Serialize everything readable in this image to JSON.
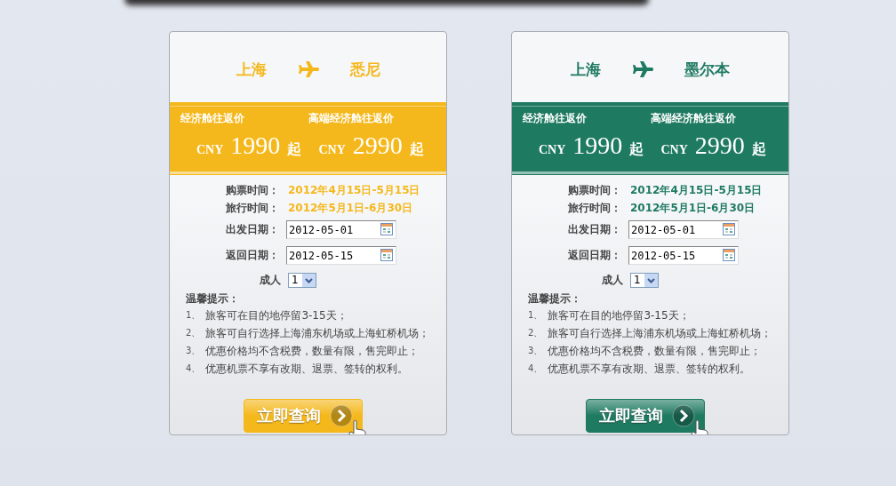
{
  "cards": [
    {
      "color": "#f5b81c",
      "origin": "上海",
      "destination": "悉尼",
      "prices": [
        {
          "label": "经济舱往返价",
          "currency": "CNY",
          "amount": "1990",
          "suffix": "起"
        },
        {
          "label": "高端经济舱往返价",
          "currency": "CNY",
          "amount": "2990",
          "suffix": "起"
        }
      ],
      "info": [
        {
          "label": "购票时间：",
          "value": "2012年4月15日-5月15日"
        },
        {
          "label": "旅行时间：",
          "value": "2012年5月1日-6月30日"
        }
      ],
      "fields": [
        {
          "label": "出发日期：",
          "value": "2012-05-01"
        },
        {
          "label": "返回日期：",
          "value": "2012-05-15"
        }
      ],
      "adults": {
        "label": "成人",
        "value": "1"
      },
      "tips_title": "温馨提示：",
      "tips": [
        {
          "num": "1、",
          "text": "旅客可在目的地停留3-15天；"
        },
        {
          "num": "2、",
          "text": "旅客可自行选择上海浦东机场或上海虹桥机场；"
        },
        {
          "num": "3、",
          "text": "优惠价格均不含税费，数量有限，售完即止；"
        },
        {
          "num": "4、",
          "text": "优惠机票不享有改期、退票、签转的权利。"
        }
      ],
      "button": "立即查询"
    },
    {
      "color": "#1f7a62",
      "origin": "上海",
      "destination": "墨尔本",
      "prices": [
        {
          "label": "经济舱往返价",
          "currency": "CNY",
          "amount": "1990",
          "suffix": "起"
        },
        {
          "label": "高端经济舱往返价",
          "currency": "CNY",
          "amount": "2990",
          "suffix": "起"
        }
      ],
      "info": [
        {
          "label": "购票时间：",
          "value": "2012年4月15日-5月15日"
        },
        {
          "label": "旅行时间：",
          "value": "2012年5月1日-6月30日"
        }
      ],
      "fields": [
        {
          "label": "出发日期：",
          "value": "2012-05-01"
        },
        {
          "label": "返回日期：",
          "value": "2012-05-15"
        }
      ],
      "adults": {
        "label": "成人",
        "value": "1"
      },
      "tips_title": "温馨提示：",
      "tips": [
        {
          "num": "1、",
          "text": "旅客可在目的地停留3-15天；"
        },
        {
          "num": "2、",
          "text": "旅客可自行选择上海浦东机场或上海虹桥机场；"
        },
        {
          "num": "3、",
          "text": "优惠价格均不含税费，数量有限，售完即止；"
        },
        {
          "num": "4、",
          "text": "优惠机票不享有改期、退票、签转的权利。"
        }
      ],
      "button": "立即查询"
    }
  ]
}
